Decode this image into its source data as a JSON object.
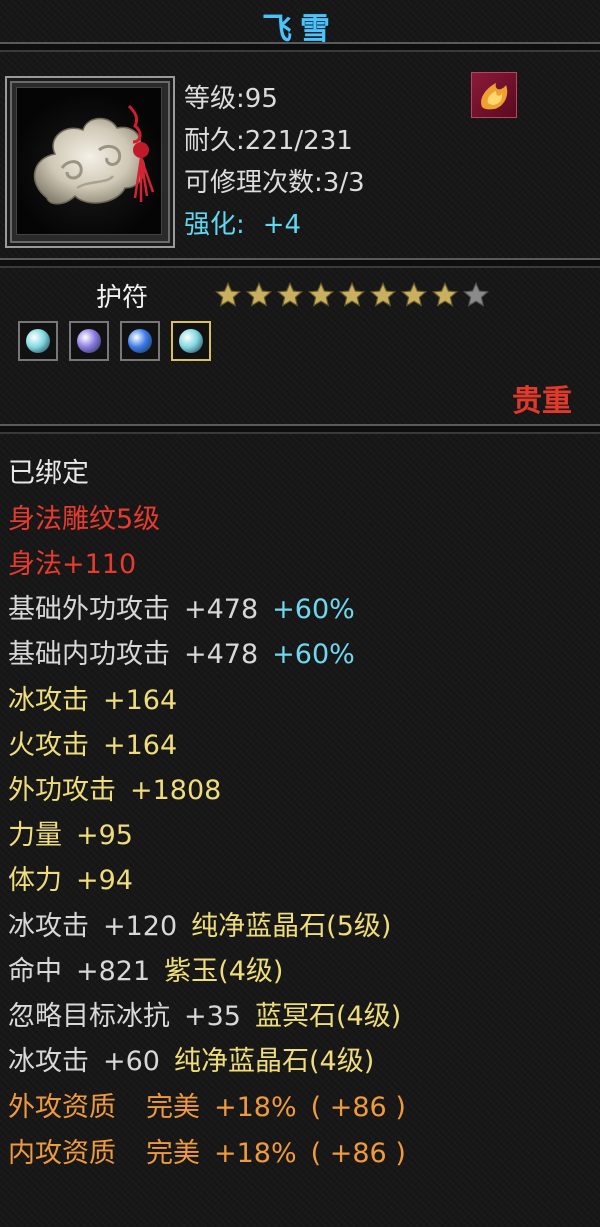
{
  "title": "飞雪",
  "item": {
    "icon": "jade-cloud-amulet-icon",
    "level_label": "等级",
    "level_value": "95",
    "durability_label": "耐久",
    "durability_value": "221/231",
    "repair_label": "可修理次数",
    "repair_value": "3/3",
    "enhance_label": "强化:",
    "enhance_value": "+4"
  },
  "type": "护符",
  "stars": {
    "filled": 8,
    "total": 9
  },
  "gems": [
    {
      "icon": "teal-gem-icon",
      "color": "#7fd8e0"
    },
    {
      "icon": "purple-gem-icon",
      "color": "#8a7ae0"
    },
    {
      "icon": "blue-gem-icon",
      "color": "#3a7ae8"
    },
    {
      "icon": "teal-gem-icon",
      "color": "#7fd8e0"
    }
  ],
  "rarity": "贵重",
  "attributes": {
    "bound": "已绑定",
    "carving": "身法雕纹5级",
    "agility": "身法+110",
    "ext_atk_name": "基础外功攻击",
    "ext_atk_val": "+478",
    "ext_atk_pct": "+60%",
    "int_atk_name": "基础内功攻击",
    "int_atk_val": "+478",
    "int_atk_pct": "+60%",
    "ice_name": "冰攻击",
    "ice_val": "+164",
    "fire_name": "火攻击",
    "fire_val": "+164",
    "ext_name": "外功攻击",
    "ext_val": "+1808",
    "str_name": "力量",
    "str_val": "+95",
    "con_name": "体力",
    "con_val": "+94",
    "gem1_stat": "冰攻击",
    "gem1_val": "+120",
    "gem1_name": "纯净蓝晶石",
    "gem1_lvl": "(5级)",
    "gem2_stat": "命中",
    "gem2_val": "+821",
    "gem2_name": "紫玉",
    "gem2_lvl": "(4级)",
    "gem3_stat": "忽略目标冰抗",
    "gem3_val": "+35",
    "gem3_name": "蓝冥石",
    "gem3_lvl": "(4级)",
    "gem4_stat": "冰攻击",
    "gem4_val": "+60",
    "gem4_name": "纯净蓝晶石",
    "gem4_lvl": "(4级)",
    "q1_name": "外攻资质",
    "q1_grade": "完美",
    "q1_pct": "+18%",
    "q1_extra": "( +86 )",
    "q2_name": "内攻资质",
    "q2_grade": "完美",
    "q2_pct": "+18%",
    "q2_extra": "( +86 )"
  },
  "colors": {
    "title": "#4fc3f7",
    "rarity": "#e23a2a",
    "bonus_pct": "#6fd8ee",
    "gem_name": "#eedd7a",
    "quality": "#f09a3e",
    "star": "#c8b060"
  }
}
